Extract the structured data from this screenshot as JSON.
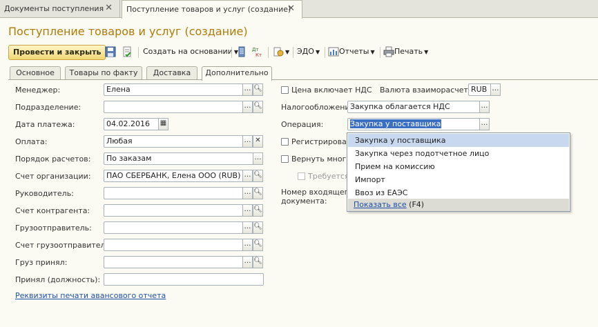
{
  "window_tabs": [
    {
      "label": "Документы поступления"
    },
    {
      "label": "Поступление товаров и услуг (создание)"
    }
  ],
  "page_title": "Поступление товаров и услуг (создание)",
  "toolbar": {
    "post_close": "Провести и закрыть",
    "create_based": "Создать на основании",
    "edo": "ЭДО",
    "reports": "Отчеты",
    "print": "Печать"
  },
  "form_tabs": [
    "Основное",
    "Товары по факту",
    "Доставка",
    "Дополнительно"
  ],
  "left": {
    "manager": {
      "label": "Менеджер:",
      "value": "Елена"
    },
    "division": {
      "label": "Подразделение:",
      "value": ""
    },
    "payment_date": {
      "label": "Дата платежа:",
      "value": "04.02.2016"
    },
    "payment": {
      "label": "Оплата:",
      "value": "Любая"
    },
    "settlement_order": {
      "label": "Порядок расчетов:",
      "value": "По заказам"
    },
    "org_account": {
      "label": "Счет организации:",
      "value": "ПАО СБЕРБАНК, Елена ООО (RUB)"
    },
    "head": {
      "label": "Руководитель:",
      "value": ""
    },
    "counterparty_account": {
      "label": "Счет контрагента:",
      "value": ""
    },
    "shipper": {
      "label": "Грузоотправитель:",
      "value": ""
    },
    "shipper_account": {
      "label": "Счет грузоотправителя:",
      "value": ""
    },
    "cargo_received": {
      "label": "Груз принял:",
      "value": ""
    },
    "received_position": {
      "label": "Принял (должность):",
      "value": ""
    },
    "print_link": "Реквизиты печати авансового отчета"
  },
  "right": {
    "price_incl_vat": "Цена включает НДС",
    "currency_label": "Валюта взаиморасчетов:",
    "currency_value": "RUB",
    "taxation_label": "Налогообложение:",
    "taxation_value": "Закупка облагается НДС",
    "operation_label": "Операция:",
    "operation_value": "Закупка у поставщика",
    "register_partial": "Регистрировать",
    "return_partial": "Вернуть многос",
    "required_partial": "Требуется",
    "incoming_number_line1": "Номер входящего",
    "incoming_number_line2": "документа:"
  },
  "dropdown": {
    "items": [
      "Закупка у поставщика",
      "Закупка через подотчетное лицо",
      "Прием на комиссию",
      "Импорт",
      "Ввоз из ЕАЭС"
    ],
    "show_all": "Показать все",
    "show_all_hint": "(F4)"
  }
}
